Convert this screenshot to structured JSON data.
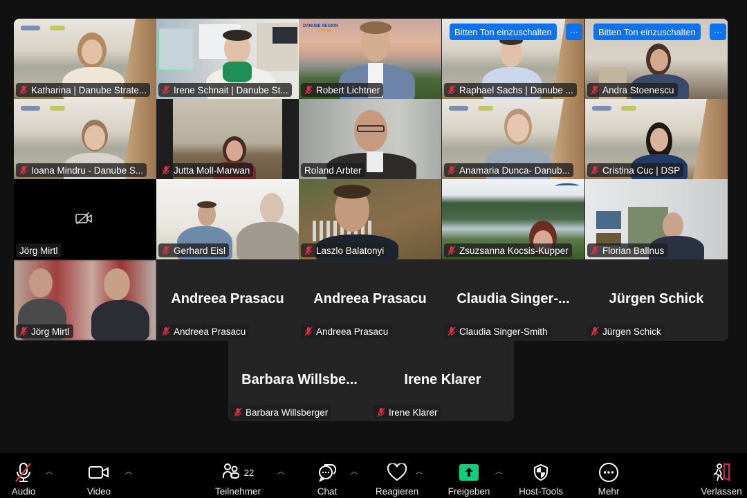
{
  "meeting": {
    "participant_count": "22",
    "unmute_request_label": "Bitten Ton einzuschalten",
    "more_options_label": "···"
  },
  "colors": {
    "active_speaker": "#23d95c",
    "request_button": "#0e72ed",
    "muted_red": "#e02f44",
    "share_green": "#0ccf7a",
    "leave_red": "#e8175d"
  },
  "tiles": [
    {
      "name": "Katharina | Danube Strate...",
      "muted": true,
      "video": true,
      "background": "danube-cliff"
    },
    {
      "name": "Irene Schnait | Danube St...",
      "muted": true,
      "video": true,
      "background": "office-map"
    },
    {
      "name": "Robert Lichtner",
      "muted": true,
      "video": true,
      "background": "danube-region-vienna"
    },
    {
      "name": "Raphael Sachs | Danube ...",
      "muted": true,
      "video": true,
      "background": "danube-cliff",
      "unmute_request": true
    },
    {
      "name": "Andra Stoenescu",
      "muted": true,
      "video": true,
      "background": "office",
      "unmute_request": true
    },
    {
      "name": "Ioana Mindru - Danube S...",
      "muted": true,
      "video": true,
      "background": "danube-cliff"
    },
    {
      "name": "Jutta Moll-Marwan",
      "muted": true,
      "video": true,
      "background": "room"
    },
    {
      "name": "Roland Arbter",
      "muted": false,
      "video": true,
      "active_speaker": true,
      "background": "room-grey"
    },
    {
      "name": "Anamaria Dunca- Danub...",
      "muted": true,
      "video": true,
      "background": "danube-cliff"
    },
    {
      "name": "Cristina Cuc | DSP",
      "muted": true,
      "video": true,
      "background": "danube-cliff"
    },
    {
      "name": "Jörg Mirtl",
      "muted": false,
      "video": false,
      "background": "none"
    },
    {
      "name": "Gerhard Eisl",
      "muted": true,
      "video": true,
      "background": "white-room"
    },
    {
      "name": "Laszlo Balatonyi",
      "muted": true,
      "video": true,
      "background": "river-aerial"
    },
    {
      "name": "Zsuzsanna Kocsis-Kupper",
      "muted": true,
      "video": true,
      "background": "danube-bend"
    },
    {
      "name": "Florian Ballnus",
      "muted": true,
      "video": true,
      "background": "office-white"
    },
    {
      "name": "Jörg Mirtl",
      "muted": true,
      "video": true,
      "background": "red-blur"
    },
    {
      "name": "Andreea Prasacu",
      "display_name": "Andreea Prasacu",
      "muted": true,
      "video": false
    },
    {
      "name": "Andreea Prasacu",
      "display_name": "Andreea Prasacu",
      "muted": true,
      "video": false
    },
    {
      "name": "Claudia Singer-Smith",
      "display_name": "Claudia  Singer-...",
      "muted": true,
      "video": false
    },
    {
      "name": "Jürgen Schick",
      "display_name": "Jürgen Schick",
      "muted": true,
      "video": false
    },
    {
      "name": "Barbara Willsberger",
      "display_name": "Barbara  Willsbe...",
      "muted": true,
      "video": false
    },
    {
      "name": "Irene Klarer",
      "display_name": "Irene Klarer",
      "muted": true,
      "video": false
    }
  ],
  "toolbar": {
    "audio": {
      "label": "Audio",
      "icon": "mic-muted-icon"
    },
    "video": {
      "label": "Video",
      "icon": "video-camera-icon"
    },
    "participants": {
      "label": "Teilnehmer",
      "icon": "participants-icon",
      "count": "22"
    },
    "chat": {
      "label": "Chat",
      "icon": "chat-icon"
    },
    "react": {
      "label": "Reagieren",
      "icon": "heart-icon"
    },
    "share": {
      "label": "Freigeben",
      "icon": "share-screen-icon"
    },
    "host_tools": {
      "label": "Host-Tools",
      "icon": "shield-icon"
    },
    "more": {
      "label": "Mehr",
      "icon": "more-icon"
    },
    "leave": {
      "label": "Verlassen",
      "icon": "leave-icon"
    }
  }
}
